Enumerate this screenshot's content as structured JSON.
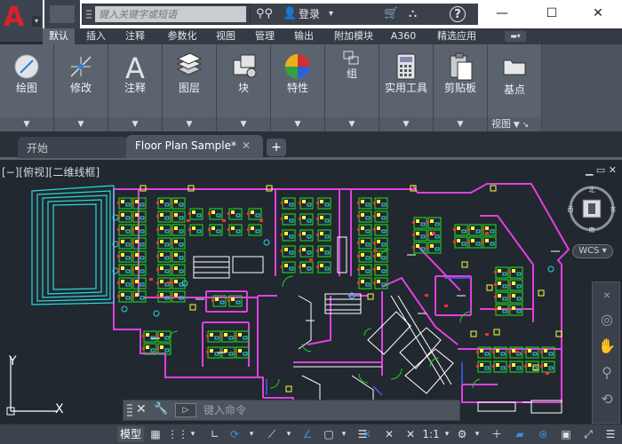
{
  "title_bar": {
    "logo_letter": "A",
    "search_placeholder": "键入关键字或短语",
    "login_label": "登录",
    "help_label": "?",
    "minimize": "—",
    "maximize": "☐",
    "close": "✕"
  },
  "ribbon": {
    "tabs": [
      {
        "label": "默认",
        "active": true
      },
      {
        "label": "插入"
      },
      {
        "label": "注释"
      },
      {
        "label": "参数化"
      },
      {
        "label": "视图"
      },
      {
        "label": "管理"
      },
      {
        "label": "输出"
      },
      {
        "label": "附加模块"
      },
      {
        "label": "A360"
      },
      {
        "label": "精选应用"
      }
    ],
    "panels": [
      {
        "label": "绘图",
        "icon": "draw-icon"
      },
      {
        "label": "修改",
        "icon": "modify-icon"
      },
      {
        "label": "注释",
        "icon": "annotation-icon"
      },
      {
        "label": "图层",
        "icon": "layers-icon"
      },
      {
        "label": "块",
        "icon": "block-icon"
      },
      {
        "label": "特性",
        "icon": "properties-icon"
      },
      {
        "label": "组",
        "icon": "group-icon"
      },
      {
        "label": "实用工具",
        "icon": "utilities-icon"
      },
      {
        "label": "剪贴板",
        "icon": "clipboard-icon"
      },
      {
        "label": "基点",
        "icon": "base-point-icon",
        "footer": "视图"
      }
    ],
    "dropdown_glyph": "▼"
  },
  "documents": {
    "tabs": [
      {
        "label": "开始"
      },
      {
        "label": "Floor Plan Sample*",
        "active": true
      }
    ],
    "new_tab": "+"
  },
  "viewport": {
    "label": "[−][俯视][二维线框]",
    "controls": "▁ ▭ ✕",
    "viewcube": {
      "north": "北",
      "south": "南",
      "east": "东",
      "west": "西"
    },
    "wcs_label": "WCS",
    "ucs": {
      "x": "X",
      "y": "Y"
    }
  },
  "command_line": {
    "placeholder": "键入命令",
    "close": "✕",
    "prompt": "▷"
  },
  "status_bar": {
    "model_label": "模型",
    "scale": "1:1"
  },
  "colors": {
    "wall": "#e040e0",
    "furniture": "#2ad8d8",
    "desk": "#21d321",
    "chair": "#ffff40",
    "red": "#ff3030",
    "white": "#ffffff",
    "blue": "#4060ff",
    "accent_blue": "#3a8fde"
  }
}
